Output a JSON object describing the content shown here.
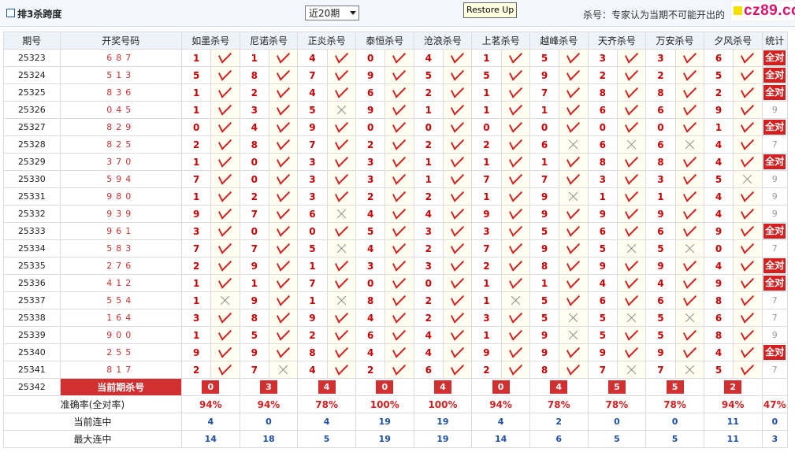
{
  "header": {
    "title": "排3杀跨度",
    "period_select": "近20期",
    "tooltip": "Restore Up",
    "note": "杀号：专家认为当期不可能开出的",
    "logo": "cz89.com"
  },
  "columns": {
    "period": "期号",
    "draw": "开奖号码",
    "experts": [
      "如墨杀号",
      "尼诺杀号",
      "正炎杀号",
      "泰恒杀号",
      "沧浪杀号",
      "上茗杀号",
      "越峰杀号",
      "天齐杀号",
      "万安杀号",
      "夕风杀号"
    ],
    "stat": "统计"
  },
  "rows": [
    {
      "period": "25323",
      "draw": "687",
      "kills": [
        [
          "1",
          1
        ],
        [
          "1",
          1
        ],
        [
          "4",
          1
        ],
        [
          "0",
          1
        ],
        [
          "4",
          1
        ],
        [
          "1",
          1
        ],
        [
          "5",
          1
        ],
        [
          "3",
          1
        ],
        [
          "3",
          1
        ],
        [
          "6",
          1
        ]
      ],
      "stat": "全对"
    },
    {
      "period": "25324",
      "draw": "513",
      "kills": [
        [
          "5",
          1
        ],
        [
          "8",
          1
        ],
        [
          "7",
          1
        ],
        [
          "9",
          1
        ],
        [
          "5",
          1
        ],
        [
          "5",
          1
        ],
        [
          "9",
          1
        ],
        [
          "2",
          1
        ],
        [
          "2",
          1
        ],
        [
          "5",
          1
        ]
      ],
      "stat": "全对"
    },
    {
      "period": "25325",
      "draw": "836",
      "kills": [
        [
          "1",
          1
        ],
        [
          "2",
          1
        ],
        [
          "4",
          1
        ],
        [
          "6",
          1
        ],
        [
          "2",
          1
        ],
        [
          "1",
          1
        ],
        [
          "7",
          1
        ],
        [
          "8",
          1
        ],
        [
          "8",
          1
        ],
        [
          "2",
          1
        ]
      ],
      "stat": "全对"
    },
    {
      "period": "25326",
      "draw": "045",
      "kills": [
        [
          "1",
          1
        ],
        [
          "3",
          1
        ],
        [
          "5",
          0
        ],
        [
          "9",
          1
        ],
        [
          "1",
          1
        ],
        [
          "1",
          1
        ],
        [
          "1",
          1
        ],
        [
          "6",
          1
        ],
        [
          "6",
          1
        ],
        [
          "9",
          1
        ]
      ],
      "stat": "9"
    },
    {
      "period": "25327",
      "draw": "829",
      "kills": [
        [
          "0",
          1
        ],
        [
          "4",
          1
        ],
        [
          "9",
          1
        ],
        [
          "0",
          1
        ],
        [
          "0",
          1
        ],
        [
          "0",
          1
        ],
        [
          "0",
          1
        ],
        [
          "0",
          1
        ],
        [
          "0",
          1
        ],
        [
          "1",
          1
        ]
      ],
      "stat": "全对"
    },
    {
      "period": "25328",
      "draw": "825",
      "kills": [
        [
          "2",
          1
        ],
        [
          "8",
          1
        ],
        [
          "7",
          1
        ],
        [
          "2",
          1
        ],
        [
          "2",
          1
        ],
        [
          "2",
          1
        ],
        [
          "6",
          0
        ],
        [
          "6",
          0
        ],
        [
          "6",
          0
        ],
        [
          "4",
          1
        ]
      ],
      "stat": "7"
    },
    {
      "period": "25329",
      "draw": "370",
      "kills": [
        [
          "1",
          1
        ],
        [
          "0",
          1
        ],
        [
          "3",
          1
        ],
        [
          "3",
          1
        ],
        [
          "1",
          1
        ],
        [
          "1",
          1
        ],
        [
          "1",
          1
        ],
        [
          "8",
          1
        ],
        [
          "8",
          1
        ],
        [
          "4",
          1
        ]
      ],
      "stat": "全对"
    },
    {
      "period": "25330",
      "draw": "594",
      "kills": [
        [
          "7",
          1
        ],
        [
          "0",
          1
        ],
        [
          "3",
          1
        ],
        [
          "3",
          1
        ],
        [
          "1",
          1
        ],
        [
          "7",
          1
        ],
        [
          "7",
          1
        ],
        [
          "3",
          1
        ],
        [
          "3",
          1
        ],
        [
          "5",
          0
        ]
      ],
      "stat": "9"
    },
    {
      "period": "25331",
      "draw": "980",
      "kills": [
        [
          "1",
          1
        ],
        [
          "2",
          1
        ],
        [
          "3",
          1
        ],
        [
          "2",
          1
        ],
        [
          "2",
          1
        ],
        [
          "1",
          1
        ],
        [
          "9",
          0
        ],
        [
          "1",
          1
        ],
        [
          "1",
          1
        ],
        [
          "4",
          1
        ]
      ],
      "stat": "9"
    },
    {
      "period": "25332",
      "draw": "939",
      "kills": [
        [
          "9",
          1
        ],
        [
          "7",
          1
        ],
        [
          "6",
          0
        ],
        [
          "4",
          1
        ],
        [
          "4",
          1
        ],
        [
          "9",
          1
        ],
        [
          "9",
          1
        ],
        [
          "9",
          1
        ],
        [
          "9",
          1
        ],
        [
          "4",
          1
        ]
      ],
      "stat": "9"
    },
    {
      "period": "25333",
      "draw": "961",
      "kills": [
        [
          "3",
          1
        ],
        [
          "0",
          1
        ],
        [
          "0",
          1
        ],
        [
          "5",
          1
        ],
        [
          "3",
          1
        ],
        [
          "3",
          1
        ],
        [
          "5",
          1
        ],
        [
          "6",
          1
        ],
        [
          "6",
          1
        ],
        [
          "9",
          1
        ]
      ],
      "stat": "全对"
    },
    {
      "period": "25334",
      "draw": "583",
      "kills": [
        [
          "7",
          1
        ],
        [
          "7",
          1
        ],
        [
          "5",
          0
        ],
        [
          "4",
          1
        ],
        [
          "2",
          1
        ],
        [
          "7",
          1
        ],
        [
          "9",
          1
        ],
        [
          "5",
          0
        ],
        [
          "5",
          0
        ],
        [
          "0",
          1
        ]
      ],
      "stat": "7"
    },
    {
      "period": "25335",
      "draw": "276",
      "kills": [
        [
          "2",
          1
        ],
        [
          "9",
          1
        ],
        [
          "1",
          1
        ],
        [
          "3",
          1
        ],
        [
          "3",
          1
        ],
        [
          "2",
          1
        ],
        [
          "8",
          1
        ],
        [
          "9",
          1
        ],
        [
          "9",
          1
        ],
        [
          "4",
          1
        ]
      ],
      "stat": "全对"
    },
    {
      "period": "25336",
      "draw": "412",
      "kills": [
        [
          "1",
          1
        ],
        [
          "1",
          1
        ],
        [
          "7",
          1
        ],
        [
          "0",
          1
        ],
        [
          "0",
          1
        ],
        [
          "1",
          1
        ],
        [
          "1",
          1
        ],
        [
          "4",
          1
        ],
        [
          "4",
          1
        ],
        [
          "9",
          1
        ]
      ],
      "stat": "全对"
    },
    {
      "period": "25337",
      "draw": "554",
      "kills": [
        [
          "1",
          0
        ],
        [
          "9",
          1
        ],
        [
          "1",
          0
        ],
        [
          "8",
          1
        ],
        [
          "2",
          1
        ],
        [
          "1",
          0
        ],
        [
          "5",
          1
        ],
        [
          "6",
          1
        ],
        [
          "6",
          1
        ],
        [
          "8",
          1
        ]
      ],
      "stat": "7"
    },
    {
      "period": "25338",
      "draw": "164",
      "kills": [
        [
          "3",
          1
        ],
        [
          "8",
          1
        ],
        [
          "9",
          1
        ],
        [
          "4",
          1
        ],
        [
          "2",
          1
        ],
        [
          "3",
          1
        ],
        [
          "5",
          0
        ],
        [
          "5",
          0
        ],
        [
          "5",
          0
        ],
        [
          "6",
          1
        ]
      ],
      "stat": "7"
    },
    {
      "period": "25339",
      "draw": "900",
      "kills": [
        [
          "1",
          1
        ],
        [
          "5",
          1
        ],
        [
          "2",
          1
        ],
        [
          "6",
          1
        ],
        [
          "4",
          1
        ],
        [
          "1",
          1
        ],
        [
          "9",
          0
        ],
        [
          "5",
          1
        ],
        [
          "5",
          1
        ],
        [
          "8",
          1
        ]
      ],
      "stat": "9"
    },
    {
      "period": "25340",
      "draw": "255",
      "kills": [
        [
          "9",
          1
        ],
        [
          "9",
          1
        ],
        [
          "8",
          1
        ],
        [
          "4",
          1
        ],
        [
          "4",
          1
        ],
        [
          "9",
          1
        ],
        [
          "9",
          1
        ],
        [
          "9",
          1
        ],
        [
          "9",
          1
        ],
        [
          "4",
          1
        ]
      ],
      "stat": "全对"
    },
    {
      "period": "25341",
      "draw": "817",
      "kills": [
        [
          "2",
          1
        ],
        [
          "7",
          0
        ],
        [
          "4",
          1
        ],
        [
          "2",
          1
        ],
        [
          "6",
          1
        ],
        [
          "2",
          1
        ],
        [
          "8",
          1
        ],
        [
          "7",
          0
        ],
        [
          "7",
          0
        ],
        [
          "5",
          1
        ]
      ],
      "stat": "7"
    }
  ],
  "current": {
    "period": "25342",
    "label": "当前期杀号",
    "kills": [
      "0",
      "3",
      "4",
      "0",
      "4",
      "0",
      "4",
      "5",
      "5",
      "2"
    ]
  },
  "summary": {
    "accuracy": {
      "label": "准确率(全对率)",
      "values": [
        "94%",
        "94%",
        "78%",
        "100%",
        "100%",
        "94%",
        "78%",
        "78%",
        "78%",
        "94%"
      ],
      "stat": "47%"
    },
    "current_streak": {
      "label": "当前连中",
      "values": [
        "4",
        "0",
        "4",
        "19",
        "19",
        "4",
        "2",
        "0",
        "0",
        "11"
      ],
      "stat": "0"
    },
    "max_streak": {
      "label": "最大连中",
      "values": [
        "14",
        "18",
        "5",
        "19",
        "19",
        "14",
        "6",
        "5",
        "5",
        "11"
      ],
      "stat": "3"
    }
  },
  "colors": {
    "accent": "#d42020",
    "blue": "#1e4fa8",
    "header_bg": "#eef3f9",
    "mark_bg": "#fffef0"
  },
  "icons": {
    "hit": "tick-icon",
    "miss": "cross-icon"
  }
}
